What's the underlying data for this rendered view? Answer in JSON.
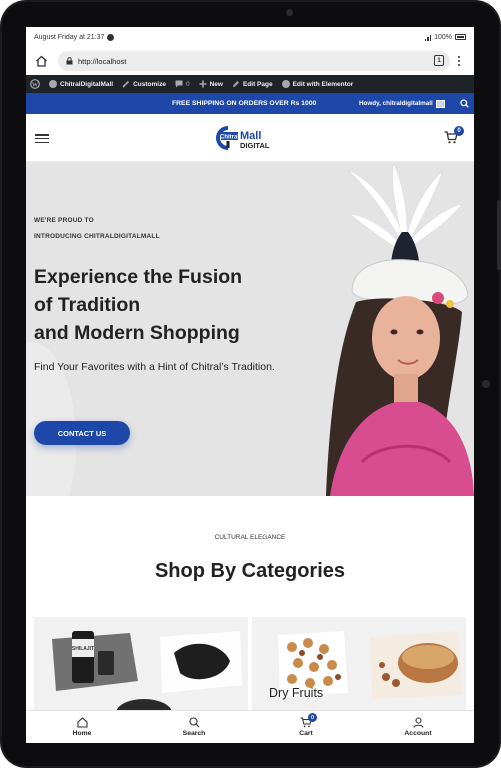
{
  "statusbar": {
    "time": "August Friday at 21:37",
    "battery": "100%"
  },
  "browser": {
    "url": "http://localhost",
    "tab_count": "1"
  },
  "adminbar": {
    "site_name": "ChitralDigitalMall",
    "customize": "Customize",
    "comments_count": "0",
    "new": "New",
    "edit_page": "Edit Page",
    "edit_elementor": "Edit with Elementor"
  },
  "announcement": {
    "message": "FREE SHIPPING ON ORDERS OVER Rs 1000",
    "howdy": "Howdy, chitraldigitalmall"
  },
  "header": {
    "logo_word1": "Chitral",
    "logo_word2": "Mall",
    "logo_word3": "DIGITAL",
    "cart_count": "0"
  },
  "hero": {
    "eyebrow_line1": "WE'RE PROUD TO",
    "eyebrow_line2": "INTRODUCING CHITRALDIGITALMALL",
    "title_line1": "Experience the Fusion",
    "title_line2": "of Tradition",
    "title_line3": "and Modern Shopping",
    "subtitle": "Find Your Favorites with a Hint of Chitral’s Tradition.",
    "cta": "CONTACT US"
  },
  "categories": {
    "eyebrow": "CULTURAL ELEGANCE",
    "title": "Shop By Categories",
    "card2_label": "Dry Fruits",
    "product_label": "SHILAJIT"
  },
  "bottom_nav": {
    "home": "Home",
    "search": "Search",
    "cart": "Cart",
    "cart_count": "0",
    "account": "Account"
  },
  "colors": {
    "brand_blue": "#1d47a8",
    "admin_bar": "#1d2327"
  }
}
